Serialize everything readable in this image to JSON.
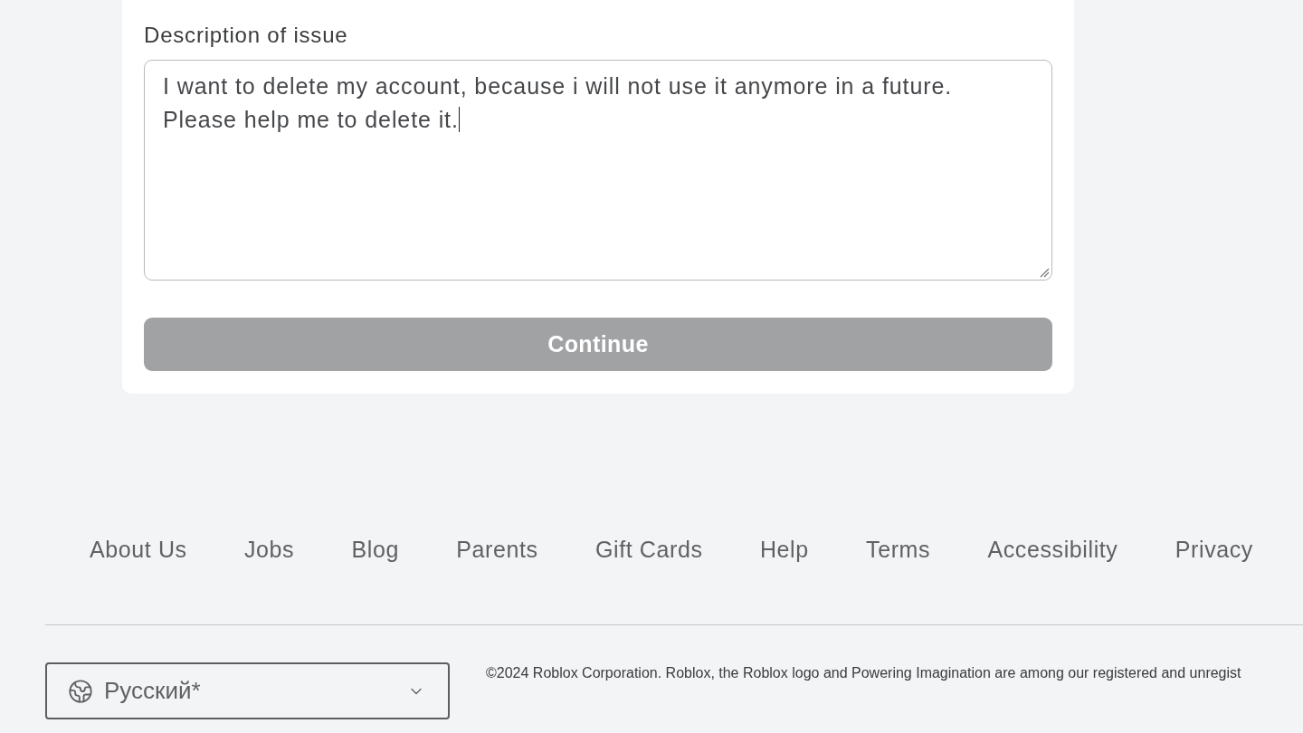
{
  "form": {
    "description": {
      "label": "Description of issue",
      "value": "I want to delete my account, because i will not use it anymore in a future.\nPlease help me to delete it.",
      "cursor": true
    },
    "continue_button": {
      "label": "Continue",
      "disabled": true
    }
  },
  "footer": {
    "links": [
      "About Us",
      "Jobs",
      "Blog",
      "Parents",
      "Gift Cards",
      "Help",
      "Terms",
      "Accessibility",
      "Privacy"
    ],
    "language_select": {
      "value": "Русский*"
    },
    "copyright": "©2024 Roblox Corporation. Roblox, the Roblox logo and Powering Imagination are among our registered and unregist"
  }
}
